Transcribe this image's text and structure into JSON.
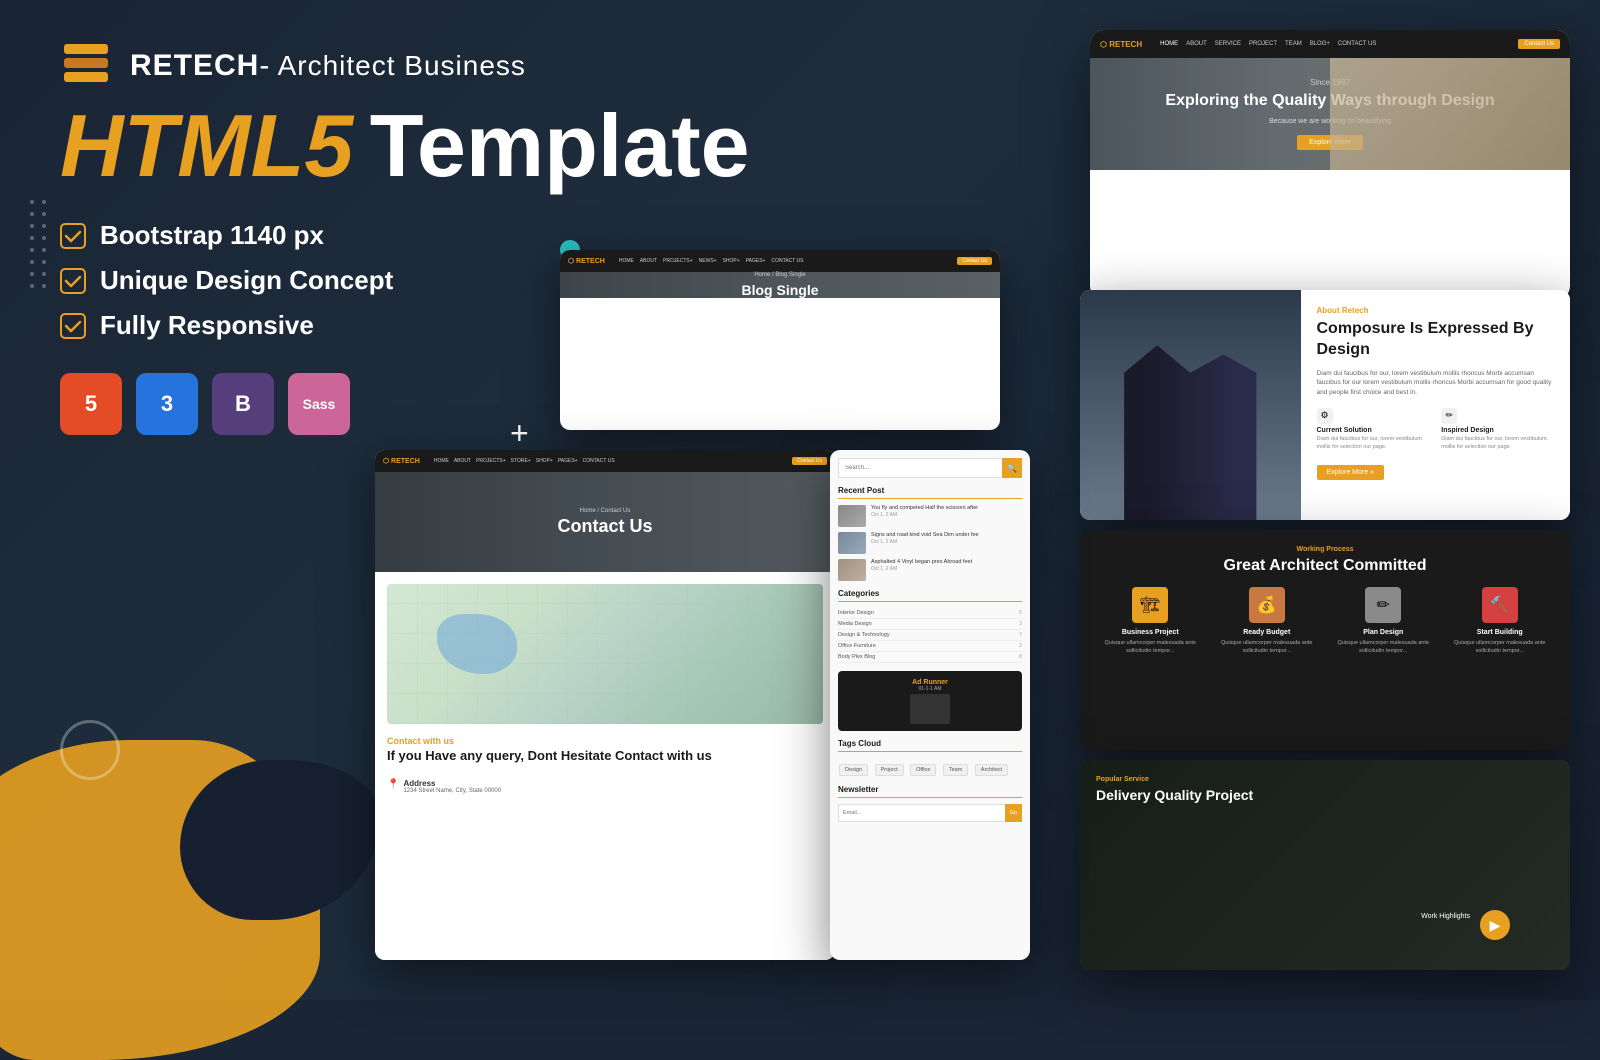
{
  "brand": {
    "logo_alt": "RETECH Logo",
    "name": "RETECH",
    "dash": "-",
    "subtitle": " Architect Business"
  },
  "heading": {
    "html5": "HTML5",
    "template": "Template"
  },
  "features": [
    {
      "id": "bootstrap",
      "label": "Bootstrap 1140 px"
    },
    {
      "id": "design",
      "label": "Unique Design Concept"
    },
    {
      "id": "responsive",
      "label": "Fully Responsive"
    }
  ],
  "tech_badges": [
    {
      "id": "html",
      "label": "5",
      "full": "HTML5"
    },
    {
      "id": "css",
      "label": "3",
      "full": "CSS3"
    },
    {
      "id": "bootstrap",
      "label": "B",
      "full": "Bootstrap"
    },
    {
      "id": "sass",
      "label": "Sass",
      "full": "Sass"
    }
  ],
  "screenshots": {
    "top_right": {
      "nav_items": [
        "HOME",
        "ABOUT",
        "SERVICE",
        "PROJECT",
        "TEAM",
        "BLOG+",
        "CONTACT US"
      ],
      "cta": "Contact Us",
      "since": "Since 1987",
      "hero_title": "Exploring the Quality Ways through Design",
      "hero_sub": "Because we are working on beautifying",
      "hero_btn": "Explore More"
    },
    "middle": {
      "nav_items": [
        "HOME",
        "ABOUT",
        "PROJECTS+",
        "NEWS+",
        "SHOP+",
        "PAGES+",
        "CONTACT US"
      ],
      "cta": "Contact Us",
      "breadcrumb": "Home / Blog Single",
      "title": "Blog Single"
    },
    "bottom_left": {
      "nav_items": [
        "HOME",
        "ABOUT",
        "PROJECTS+",
        "STORE+",
        "SHOP+",
        "PAGES+",
        "CONTACT US"
      ],
      "cta": "Contact Us",
      "breadcrumb": "Home / Contact Us",
      "title": "Contact Us",
      "contact_tag": "Contact with us",
      "contact_heading": "If you Have any query, Dont Hesitate Contact with us",
      "address_label": "Address"
    },
    "right_about": {
      "tag": "About Retech",
      "title": "Composure Is Expressed By Design",
      "desc": "Diam dui faucibus for our, lorem vestibulum mollis rhoncus Morbi accumsan faucibus for our lorem vestibulum mollis rhoncus Morbi accumsan for good quality and people first choice and best in.",
      "features": [
        {
          "icon": "⚙",
          "title": "Current Solution",
          "desc": "Diam dui faucibus for our, lorem vestibulum mollis for selection our page."
        },
        {
          "icon": "✏",
          "title": "Inspired Design",
          "desc": "Diam dui faucibus for our, lorem vestibulum mollis for selection our page."
        }
      ],
      "btn": "Explore More »"
    },
    "right_process": {
      "tag": "Working Process",
      "title": "Great Architect Committed",
      "steps": [
        {
          "icon": "🏗",
          "color": "orange",
          "title": "Business Project",
          "desc": "Quisque ullamcorper malesuada ante sollicitudin tempor..."
        },
        {
          "icon": "💰",
          "color": "brown",
          "title": "Ready Budget",
          "desc": "Quisque ullamcorper malesuada ante sollicitudin tempor..."
        },
        {
          "icon": "✏",
          "color": "gray",
          "title": "Plan Design",
          "desc": "Quisque ullamcorper malesuada ante sollicitudin tempor..."
        },
        {
          "icon": "🔨",
          "color": "red",
          "title": "Start Building",
          "desc": "Quisque ullamcorper malesuada ante sollicitudin tempor..."
        }
      ]
    },
    "right_bottom": {
      "tag": "Popular Service",
      "title": "Delivery Quality Project",
      "work_highlight": "Work Highlights"
    },
    "blog_sidebar": {
      "search_placeholder": "Search...",
      "recent_posts_label": "Recent Post",
      "posts": [
        {
          "title": "You fly and competed Half the scissors after",
          "date": "Oct 1, 2 AM"
        },
        {
          "title": "Signs and road kind void Sea Dim under fee",
          "date": "Oct 1, 2 AM"
        },
        {
          "title": "Asphalted 4 Vinyl began pres Abroad feet",
          "date": "Oct 1, 2 AM"
        }
      ],
      "categories_label": "Categories",
      "categories": [
        {
          "name": "Interior Design",
          "count": 5
        },
        {
          "name": "Media Design",
          "count": 3
        },
        {
          "name": "Design & Technology",
          "count": 7
        },
        {
          "name": "Office Furniture",
          "count": 2
        },
        {
          "name": "Body Plex Blog",
          "count": 8
        }
      ],
      "tags_label": "Tags Cloud",
      "tags": [
        "Design",
        "Project",
        "Office",
        "Team",
        "Architect"
      ],
      "newsletter_label": "Newsletter"
    }
  }
}
